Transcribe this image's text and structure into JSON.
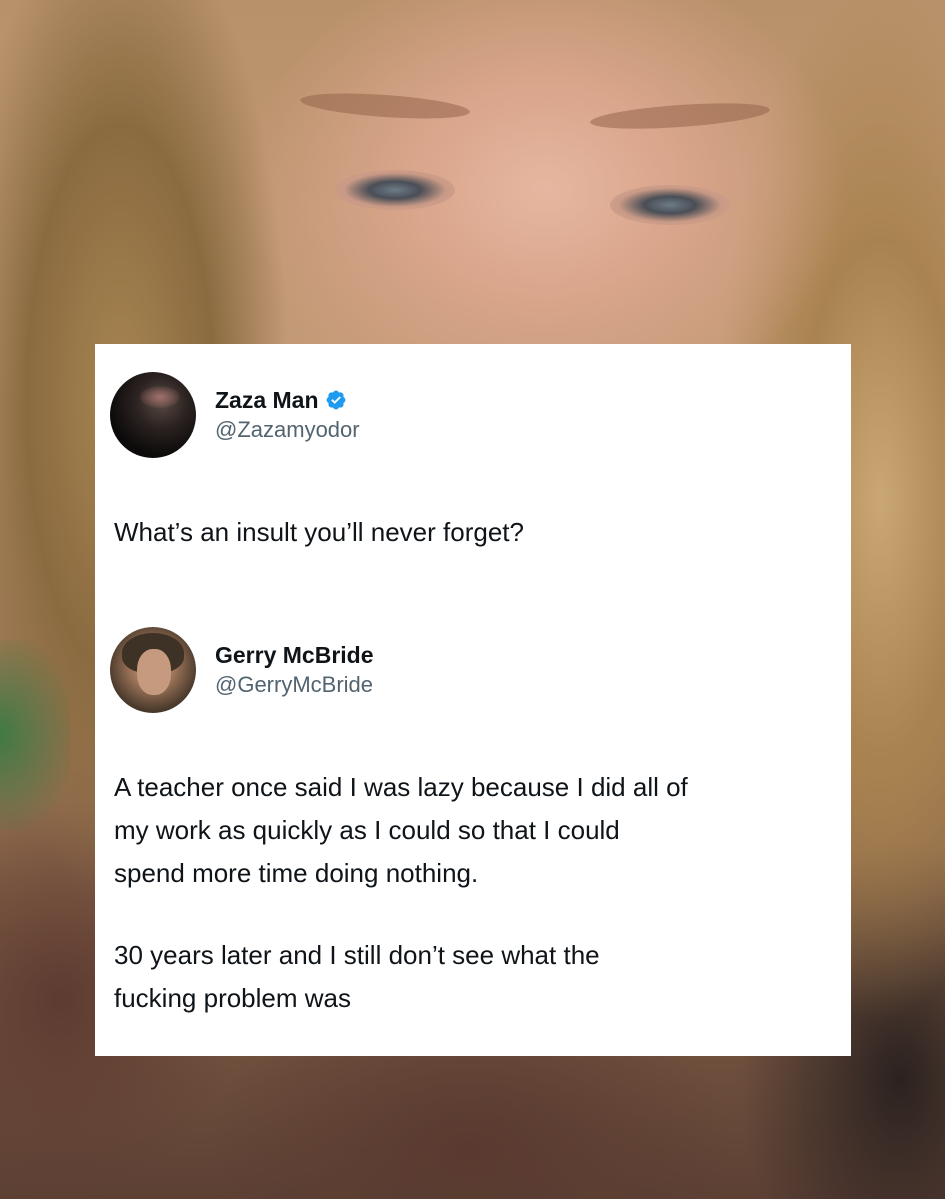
{
  "tweets": [
    {
      "display_name": "Zaza Man",
      "handle": "@Zazamyodor",
      "verified": true,
      "text": "What’s an insult you’ll never forget?"
    },
    {
      "display_name": "Gerry McBride",
      "handle": "@GerryMcBride",
      "verified": false,
      "paragraphs": [
        "A teacher once said I was lazy because I did all of\nmy work as quickly as I could so that I could\nspend more time doing nothing.",
        "30 years later and I still don’t see what the\nfucking problem was"
      ]
    }
  ],
  "colors": {
    "card_background": "#ffffff",
    "text": "#0f1419",
    "handle": "#536471",
    "verified_badge": "#1d9bf0"
  },
  "icons": [
    "verified-badge-icon"
  ]
}
